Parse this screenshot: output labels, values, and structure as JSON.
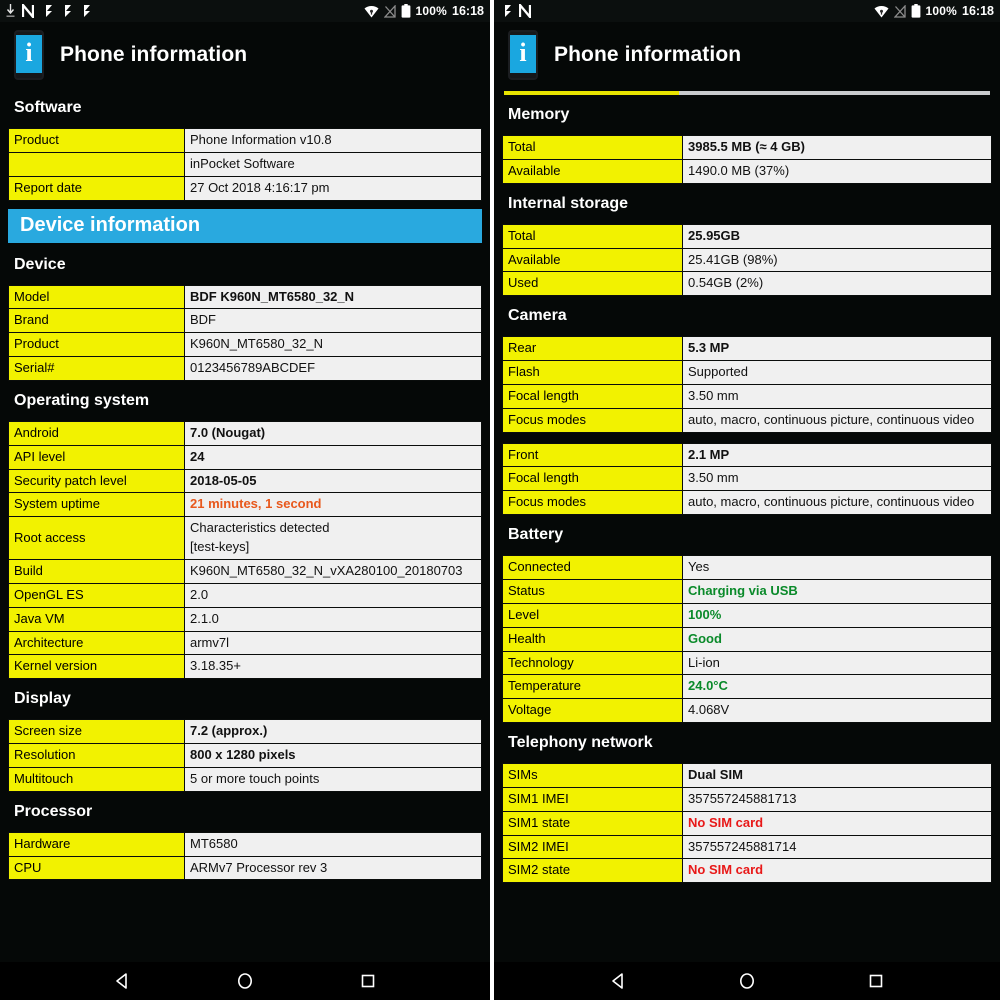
{
  "app": {
    "title": "Phone information",
    "icon": "phone-info-icon",
    "accent_blue": "#29a9df",
    "key_cell_yellow": "#f2f200",
    "value_cell_gray": "#f0f0f0"
  },
  "status_bar": {
    "left_icons": [
      "download-icon",
      "nfc-icon",
      "flag-icon",
      "flag-icon",
      "flag-icon"
    ],
    "left_icons_right_screen": [
      "flag-icon",
      "nfc-icon"
    ],
    "wifi_icon": "wifi-icon",
    "signal_icon": "no-signal-icon",
    "battery_icon": "battery-full-icon",
    "battery_percent": "100%",
    "time": "16:18"
  },
  "nav_bar": {
    "back": "back-triangle-icon",
    "home": "home-circle-icon",
    "recents": "recents-square-icon"
  },
  "left_screen": {
    "sections": [
      {
        "title": "Software",
        "rows": [
          {
            "key": "Product",
            "value": "Phone Information v10.8",
            "style": "normal"
          },
          {
            "key": "",
            "value": "inPocket Software",
            "style": "normal"
          },
          {
            "key": "Report date",
            "value": "27 Oct 2018 4:16:17 pm",
            "style": "normal"
          }
        ]
      }
    ],
    "banner": "Device information",
    "sections2": [
      {
        "title": "Device",
        "rows": [
          {
            "key": "Model",
            "value": "BDF K960N_MT6580_32_N",
            "style": "bold"
          },
          {
            "key": "Brand",
            "value": "BDF",
            "style": "normal"
          },
          {
            "key": "Product",
            "value": "K960N_MT6580_32_N",
            "style": "normal"
          },
          {
            "key": "Serial#",
            "value": "0123456789ABCDEF",
            "style": "normal"
          }
        ]
      },
      {
        "title": "Operating system",
        "rows": [
          {
            "key": "Android",
            "value": "7.0 (Nougat)",
            "style": "bold"
          },
          {
            "key": "API level",
            "value": "24",
            "style": "bold"
          },
          {
            "key": "Security patch level",
            "value": "2018-05-05",
            "style": "bold"
          },
          {
            "key": "System uptime",
            "value": "21 minutes, 1 second",
            "style": "orange"
          },
          {
            "key": "Root access",
            "value": "Characteristics detected\n[test-keys]",
            "style": "normal"
          },
          {
            "key": "Build",
            "value": "K960N_MT6580_32_N_vXA280100_20180703",
            "style": "normal"
          },
          {
            "key": "OpenGL ES",
            "value": "2.0",
            "style": "normal"
          },
          {
            "key": "Java VM",
            "value": "2.1.0",
            "style": "normal"
          },
          {
            "key": "Architecture",
            "value": "armv7l",
            "style": "normal"
          },
          {
            "key": "Kernel version",
            "value": "3.18.35+",
            "style": "normal"
          }
        ]
      },
      {
        "title": "Display",
        "rows": [
          {
            "key": "Screen size",
            "value": "7.2 (approx.)",
            "style": "bold"
          },
          {
            "key": "Resolution",
            "value": "800 x 1280 pixels",
            "style": "bold"
          },
          {
            "key": "Multitouch",
            "value": "5 or more touch points",
            "style": "normal"
          }
        ]
      },
      {
        "title": "Processor",
        "rows": [
          {
            "key": "Hardware",
            "value": "MT6580",
            "style": "normal"
          },
          {
            "key": "CPU",
            "value": "ARMv7 Processor rev 3",
            "style": "normal"
          }
        ]
      }
    ]
  },
  "right_screen": {
    "loading_percent": 36,
    "sections": [
      {
        "title": "Memory",
        "rows": [
          {
            "key": "Total",
            "value": "3985.5 MB (≈ 4 GB)",
            "style": "bold"
          },
          {
            "key": "Available",
            "value": "1490.0 MB (37%)",
            "style": "normal"
          }
        ]
      },
      {
        "title": "Internal storage",
        "rows": [
          {
            "key": "Total",
            "value": "25.95GB",
            "style": "bold"
          },
          {
            "key": "Available",
            "value": "25.41GB (98%)",
            "style": "normal"
          },
          {
            "key": "Used",
            "value": "0.54GB (2%)",
            "style": "normal"
          }
        ]
      },
      {
        "title": "Camera",
        "rows": [
          {
            "key": "Rear",
            "value": "5.3 MP",
            "style": "bold"
          },
          {
            "key": "Flash",
            "value": "Supported",
            "style": "normal"
          },
          {
            "key": "Focal length",
            "value": "3.50 mm",
            "style": "normal"
          },
          {
            "key": "Focus modes",
            "value": "auto, macro, continuous picture, continuous video",
            "style": "normal"
          }
        ]
      },
      {
        "title": "",
        "rows": [
          {
            "key": "Front",
            "value": "2.1 MP",
            "style": "bold"
          },
          {
            "key": "Focal length",
            "value": "3.50 mm",
            "style": "normal"
          },
          {
            "key": "Focus modes",
            "value": "auto, macro, continuous picture, continuous video",
            "style": "normal"
          }
        ]
      },
      {
        "title": "Battery",
        "rows": [
          {
            "key": "Connected",
            "value": "Yes",
            "style": "normal"
          },
          {
            "key": "Status",
            "value": "Charging via USB",
            "style": "green"
          },
          {
            "key": "Level",
            "value": "100%",
            "style": "green"
          },
          {
            "key": "Health",
            "value": "Good",
            "style": "green"
          },
          {
            "key": "Technology",
            "value": "Li-ion",
            "style": "normal"
          },
          {
            "key": "Temperature",
            "value": "24.0°C",
            "style": "green"
          },
          {
            "key": "Voltage",
            "value": "4.068V",
            "style": "normal"
          }
        ]
      },
      {
        "title": "Telephony network",
        "rows": [
          {
            "key": "SIMs",
            "value": "Dual SIM",
            "style": "bold"
          },
          {
            "key": "SIM1 IMEI",
            "value": "357557245881713",
            "style": "normal"
          },
          {
            "key": "SIM1 state",
            "value": "No SIM card",
            "style": "red"
          },
          {
            "key": "SIM2 IMEI",
            "value": "357557245881714",
            "style": "normal"
          },
          {
            "key": "SIM2 state",
            "value": "No SIM card",
            "style": "red"
          }
        ]
      }
    ]
  }
}
